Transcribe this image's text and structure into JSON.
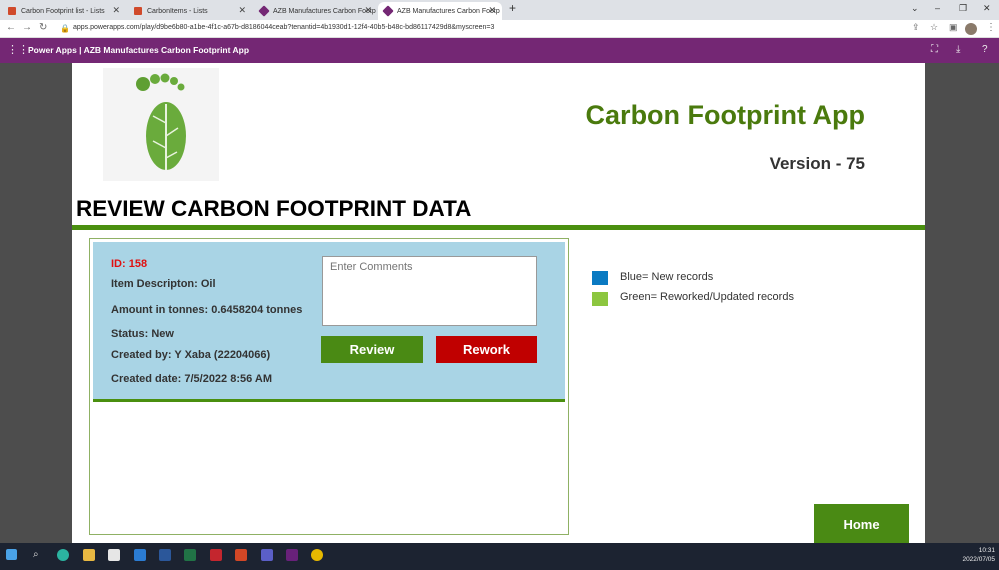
{
  "browser": {
    "tabs": [
      {
        "label": "Carbon Footprint list - Lists",
        "color": "#d04a2b"
      },
      {
        "label": "CarbonItems - Lists",
        "color": "#d04a2b"
      },
      {
        "label": "AZB Manufactures Carbon Footp",
        "color": "#742774"
      },
      {
        "label": "AZB Manufactures Carbon Footp",
        "color": "#742774"
      }
    ],
    "new_tab": "+",
    "url": "apps.powerapps.com/play/d9be6b80-a1be-4f1c-a67b-d8186044ceab?tenantid=4b1930d1-12f4-40b5-b48c-bd86117429d8&myscreen=3"
  },
  "powerapps_header": {
    "title": "Power Apps  |  AZB Manufactures Carbon Footprint App"
  },
  "app": {
    "title": "Carbon Footprint App",
    "version": "Version - 75",
    "page_heading": "REVIEW CARBON FOOTPRINT DATA",
    "record": {
      "id": "ID: 158",
      "description": "Item Descripton: Oil",
      "amount": "Amount in tonnes: 0.6458204 tonnes",
      "status": "Status: New",
      "created_by": "Created by: Y Xaba (22204066)",
      "created_date": "Created date: 7/5/2022 8:56 AM"
    },
    "comments_placeholder": "Enter Comments",
    "review_button": "Review",
    "rework_button": "Rework",
    "legend": [
      {
        "color": "#0a7ac2",
        "label": "Blue= New records"
      },
      {
        "color": "#8cc63f",
        "label": "Green= Reworked/Updated records"
      }
    ],
    "home_button": "Home"
  },
  "taskbar": {
    "time": "10:31",
    "date": "2022/07/05"
  }
}
